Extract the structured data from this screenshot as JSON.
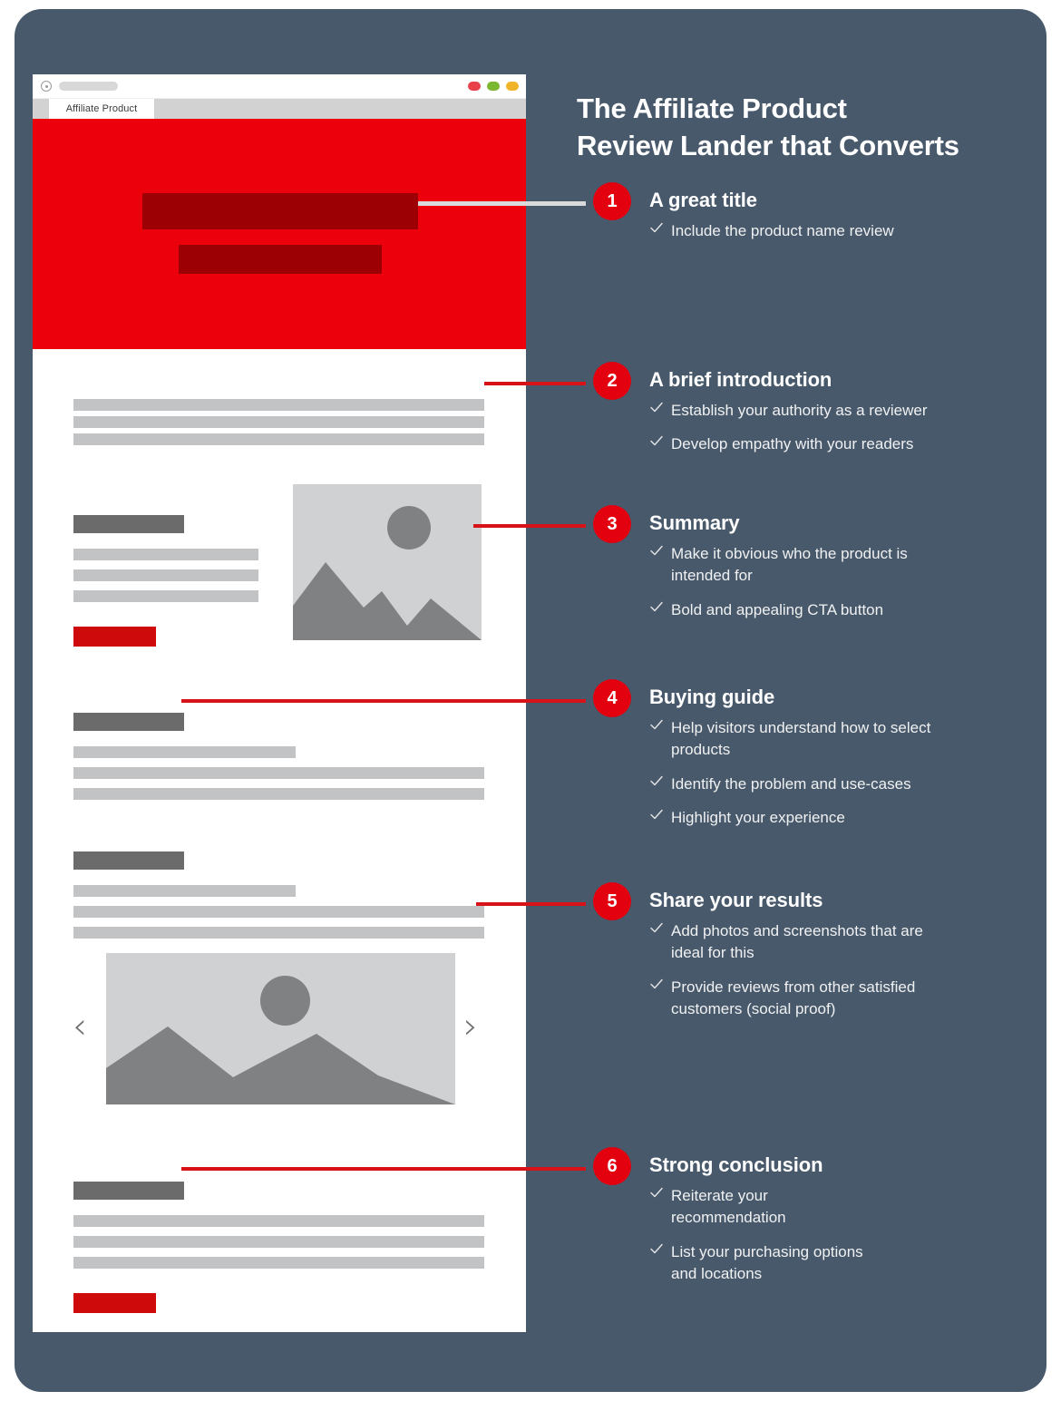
{
  "headline": "The Affiliate Product\nReview Lander that Converts",
  "colors": {
    "background": "#48596b",
    "accent_red": "#e3000f",
    "hero_red": "#ec000c",
    "connector_red": "#d81219",
    "wire_light": "#c2c3c5",
    "wire_dark": "#6b6b6b"
  },
  "browser": {
    "tab_label": "Affiliate Product",
    "window_dots": [
      "red",
      "green",
      "yellow"
    ],
    "address_icon": "target-icon",
    "carousel": {
      "prev": "‹",
      "next": "›"
    }
  },
  "steps": [
    {
      "number": "1",
      "title": "A great title",
      "points": [
        "Include the product name review"
      ]
    },
    {
      "number": "2",
      "title": "A brief introduction",
      "points": [
        "Establish your authority as a reviewer",
        "Develop empathy with your readers"
      ]
    },
    {
      "number": "3",
      "title": "Summary",
      "points": [
        "Make it obvious who the product is intended for",
        "Bold and appealing CTA button"
      ]
    },
    {
      "number": "4",
      "title": "Buying guide",
      "points": [
        "Help visitors understand how to select products",
        "Identify the problem and use-cases",
        "Highlight your experience"
      ]
    },
    {
      "number": "5",
      "title": "Share your results",
      "points": [
        "Add photos and screenshots that are ideal for this",
        "Provide reviews from other satisfied customers (social proof)"
      ]
    },
    {
      "number": "6",
      "title": "Strong conclusion",
      "points": [
        "Reiterate your recommendation",
        "List your purchasing options and locations"
      ]
    }
  ]
}
